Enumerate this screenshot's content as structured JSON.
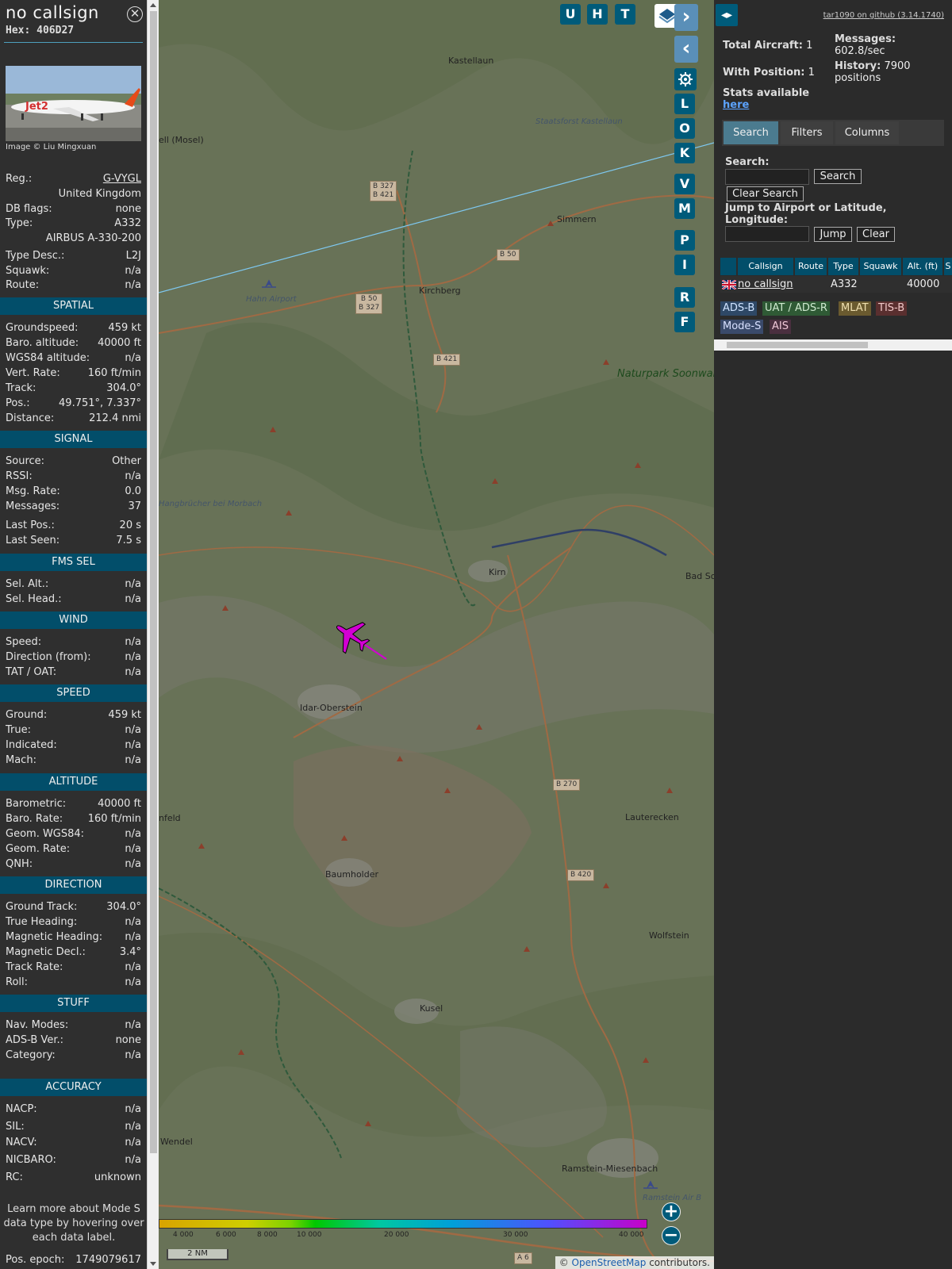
{
  "aircraft": {
    "callsign": "no callsign",
    "hex_label": "Hex:",
    "hex": "406D27",
    "photo_credit": "Image © Liu Mingxuan"
  },
  "details": {
    "reg": {
      "label": "Reg.:",
      "value": "G-VYGL"
    },
    "country": "United Kingdom",
    "db_flags": {
      "label": "DB flags:",
      "value": "none"
    },
    "type": {
      "label": "Type:",
      "value": "A332"
    },
    "type_name": "AIRBUS A-330-200",
    "type_desc": {
      "label": "Type Desc.:",
      "value": "L2J"
    },
    "squawk": {
      "label": "Squawk:",
      "value": "n/a"
    },
    "route": {
      "label": "Route:",
      "value": "n/a"
    }
  },
  "sections": {
    "spatial": "SPATIAL",
    "signal": "SIGNAL",
    "fms": "FMS SEL",
    "wind": "WIND",
    "speed": "SPEED",
    "altitude": "ALTITUDE",
    "direction": "DIRECTION",
    "stuff": "STUFF",
    "accuracy": "ACCURACY"
  },
  "spatial": [
    {
      "k": "Groundspeed:",
      "v": "459 kt"
    },
    {
      "k": "Baro. altitude:",
      "v": "40000 ft"
    },
    {
      "k": "WGS84 altitude:",
      "v": "n/a"
    },
    {
      "k": "Vert. Rate:",
      "v": "160 ft/min"
    },
    {
      "k": "Track:",
      "v": "304.0°"
    },
    {
      "k": "Pos.:",
      "v": "49.751°, 7.337°"
    },
    {
      "k": "Distance:",
      "v": "212.4 nmi"
    }
  ],
  "signal": [
    {
      "k": "Source:",
      "v": "Other"
    },
    {
      "k": "RSSI:",
      "v": "n/a"
    },
    {
      "k": "Msg. Rate:",
      "v": "0.0"
    },
    {
      "k": "Messages:",
      "v": "37"
    },
    {
      "k": "Last Pos.:",
      "v": "20 s"
    },
    {
      "k": "Last Seen:",
      "v": "7.5 s"
    }
  ],
  "fms": [
    {
      "k": "Sel. Alt.:",
      "v": "n/a"
    },
    {
      "k": "Sel. Head.:",
      "v": "n/a"
    }
  ],
  "wind": [
    {
      "k": "Speed:",
      "v": "n/a"
    },
    {
      "k": "Direction (from):",
      "v": "n/a"
    },
    {
      "k": "TAT / OAT:",
      "v": "n/a"
    }
  ],
  "speed": [
    {
      "k": "Ground:",
      "v": "459 kt"
    },
    {
      "k": "True:",
      "v": "n/a"
    },
    {
      "k": "Indicated:",
      "v": "n/a"
    },
    {
      "k": "Mach:",
      "v": "n/a"
    }
  ],
  "altitude": [
    {
      "k": "Barometric:",
      "v": "40000 ft"
    },
    {
      "k": "Baro. Rate:",
      "v": "160 ft/min"
    },
    {
      "k": "Geom. WGS84:",
      "v": "n/a"
    },
    {
      "k": "Geom. Rate:",
      "v": "n/a"
    },
    {
      "k": "QNH:",
      "v": "n/a"
    }
  ],
  "direction": [
    {
      "k": "Ground Track:",
      "v": "304.0°"
    },
    {
      "k": "True Heading:",
      "v": "n/a"
    },
    {
      "k": "Magnetic Heading:",
      "v": "n/a"
    },
    {
      "k": "Magnetic Decl.:",
      "v": "3.4°"
    },
    {
      "k": "Track Rate:",
      "v": "n/a"
    },
    {
      "k": "Roll:",
      "v": "n/a"
    }
  ],
  "stuff": [
    {
      "k": "Nav. Modes:",
      "v": "n/a"
    },
    {
      "k": "ADS-B Ver.:",
      "v": "none"
    },
    {
      "k": "Category:",
      "v": "n/a"
    }
  ],
  "accuracy": [
    {
      "k": "NACP:",
      "v": "n/a"
    },
    {
      "k": "SIL:",
      "v": "n/a"
    },
    {
      "k": "NACV:",
      "v": "n/a"
    },
    {
      "k": "NICBARO:",
      "v": "n/a"
    },
    {
      "k": "RC:",
      "v": "unknown"
    }
  ],
  "learn_more": "Learn more about Mode S data type by hovering over each data label.",
  "pos_epoch": {
    "k": "Pos. epoch:",
    "v": "1749079617"
  },
  "map": {
    "buttons": [
      "U",
      "H",
      "T"
    ],
    "side_buttons": [
      "L",
      "O",
      "K",
      "V",
      "M",
      "P",
      "I",
      "R",
      "F"
    ],
    "towns": [
      "Kastellaun",
      "ell (Mosel)",
      "Staatsforst Kastellaun",
      "Simmern",
      "Hahn Airport",
      "Kirchberg",
      "Kirn",
      "Bad So",
      "Idar-Oberstein",
      "Lauterecken",
      "Baumholder",
      "Wolfstein",
      "Kusel",
      "Wendel",
      "Ramstein-Miesenbach",
      "Ramstein Air B",
      "nfeld",
      "Hangbrücher bei Morbach"
    ],
    "park": "Naturpark Soonwald-Nahe",
    "roads": [
      "B 327",
      "B 421",
      "B 50",
      "B 50",
      "B 327",
      "B 421",
      "B 270",
      "B 420",
      "A 6"
    ],
    "legend_ticks": [
      "4 000",
      "6 000",
      "8 000",
      "10 000",
      "20 000",
      "30 000",
      "40 000"
    ],
    "scale": "2 NM",
    "attribution_prefix": "©",
    "attribution_link": "OpenStreetMap",
    "attribution_suffix": "contributors.",
    "legend_colors": [
      "#d9a300",
      "#cfcf00",
      "#7bd200",
      "#00c800",
      "#00c8a0",
      "#00a0d8",
      "#5050ff",
      "#c800c8"
    ]
  },
  "right": {
    "github": "tar1090 on github (3.14.1740)",
    "total_aircraft": {
      "label": "Total Aircraft:",
      "value": "1"
    },
    "with_position": {
      "label": "With Position:",
      "value": "1"
    },
    "messages": {
      "label": "Messages:",
      "value": "602.8/sec"
    },
    "history": {
      "label": "History:",
      "value": "7900 positions"
    },
    "stats": {
      "label": "Stats available",
      "link": "here"
    },
    "tabs": [
      "Search",
      "Filters",
      "Columns"
    ],
    "search_label": "Search:",
    "search_button": "Search",
    "clear_search": "Clear Search",
    "jump_label": "Jump to Airport or Latitude, Longitude:",
    "jump_button": "Jump",
    "clear_button": "Clear",
    "columns": [
      "Callsign",
      "Route",
      "Type",
      "Squawk",
      "Alt. (ft)",
      "S"
    ],
    "row": {
      "callsign": "no callsign",
      "route": "",
      "type": "A332",
      "squawk": "",
      "alt": "40000"
    },
    "source_tags": [
      "ADS-B",
      "UAT / ADS-R",
      "MLAT",
      "TIS-B",
      "Mode-S",
      "AIS"
    ]
  }
}
